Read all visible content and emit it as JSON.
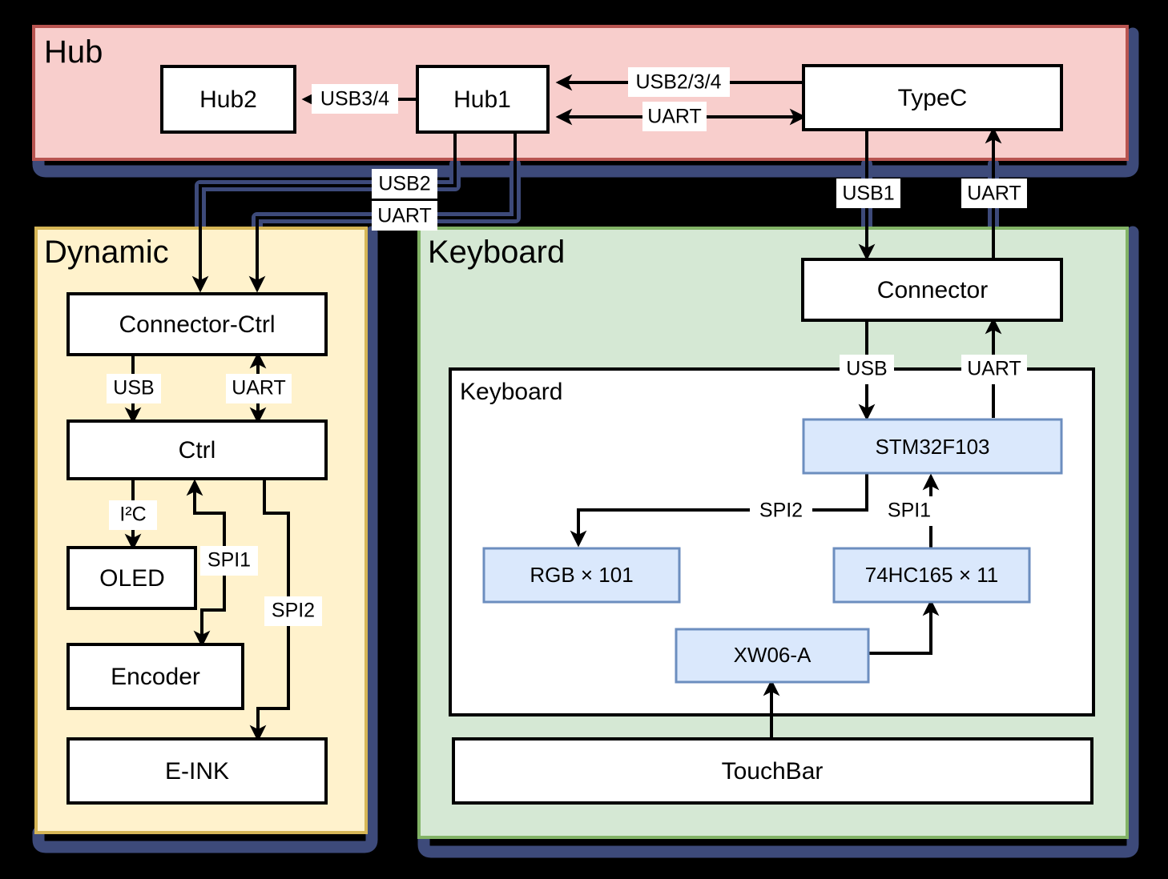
{
  "diagram": {
    "title": "Hub / Dynamic / Keyboard hardware block diagram",
    "colors": {
      "background": "#000000",
      "hub_fill": "#F8CECC",
      "hub_border": "#B85450",
      "dynamic_fill": "#FFF2CC",
      "dynamic_border": "#D6B656",
      "keyboard_fill": "#D5E8D4",
      "keyboard_border": "#82B366",
      "chip_fill": "#DAE8FC",
      "chip_border": "#6C8EBF",
      "node_fill": "#FFFFFF",
      "node_border": "#000000",
      "shadow": "#3D4A7A"
    },
    "groups": [
      {
        "id": "hub",
        "label": "Hub"
      },
      {
        "id": "dynamic",
        "label": "Dynamic"
      },
      {
        "id": "keyboard",
        "label": "Keyboard"
      },
      {
        "id": "keyboard-inner",
        "label": "Keyboard"
      }
    ],
    "nodes": [
      {
        "id": "hub2",
        "label": "Hub2",
        "group": "hub",
        "style": "white"
      },
      {
        "id": "hub1",
        "label": "Hub1",
        "group": "hub",
        "style": "white"
      },
      {
        "id": "typec",
        "label": "TypeC",
        "group": "hub",
        "style": "white"
      },
      {
        "id": "connector-ctrl",
        "label": "Connector-Ctrl",
        "group": "dynamic",
        "style": "white"
      },
      {
        "id": "ctrl",
        "label": "Ctrl",
        "group": "dynamic",
        "style": "white"
      },
      {
        "id": "oled",
        "label": "OLED",
        "group": "dynamic",
        "style": "white"
      },
      {
        "id": "encoder",
        "label": "Encoder",
        "group": "dynamic",
        "style": "white"
      },
      {
        "id": "eink",
        "label": "E-INK",
        "group": "dynamic",
        "style": "white"
      },
      {
        "id": "connector",
        "label": "Connector",
        "group": "keyboard",
        "style": "white"
      },
      {
        "id": "stm32f103",
        "label": "STM32F103",
        "group": "keyboard-inner",
        "style": "blue"
      },
      {
        "id": "rgb",
        "label": "RGB × 101",
        "group": "keyboard-inner",
        "style": "blue"
      },
      {
        "id": "hc165",
        "label": "74HC165 × 11",
        "group": "keyboard-inner",
        "style": "blue"
      },
      {
        "id": "xw06a",
        "label": "XW06-A",
        "group": "keyboard-inner",
        "style": "blue"
      },
      {
        "id": "touchbar",
        "label": "TouchBar",
        "group": "keyboard",
        "style": "white"
      }
    ],
    "edges": [
      {
        "id": "e-hub1-hub2",
        "from": "hub1",
        "to": "hub2",
        "label": "USB3/4",
        "direction": "one-way"
      },
      {
        "id": "e-typec-hub1-usb",
        "from": "typec",
        "to": "hub1",
        "label": "USB2/3/4",
        "direction": "one-way"
      },
      {
        "id": "e-typec-hub1-uart",
        "from": "typec",
        "to": "hub1",
        "label": "UART",
        "direction": "two-way"
      },
      {
        "id": "e-hub1-dyn-usb2",
        "from": "hub1",
        "to": "connector-ctrl",
        "label": "USB2",
        "direction": "one-way"
      },
      {
        "id": "e-hub1-dyn-uart",
        "from": "hub1",
        "to": "connector-ctrl",
        "label": "UART",
        "direction": "one-way"
      },
      {
        "id": "e-typec-connector-usb1",
        "from": "typec",
        "to": "connector",
        "label": "USB1",
        "direction": "one-way"
      },
      {
        "id": "e-typec-connector-uart",
        "from": "connector",
        "to": "typec",
        "label": "UART",
        "direction": "one-way"
      },
      {
        "id": "e-cc-ctrl-usb",
        "from": "connector-ctrl",
        "to": "ctrl",
        "label": "USB",
        "direction": "one-way"
      },
      {
        "id": "e-cc-ctrl-uart",
        "from": "ctrl",
        "to": "connector-ctrl",
        "label": "UART",
        "direction": "two-way"
      },
      {
        "id": "e-ctrl-oled",
        "from": "ctrl",
        "to": "oled",
        "label": "I²C",
        "direction": "one-way"
      },
      {
        "id": "e-encoder-ctrl",
        "from": "encoder",
        "to": "ctrl",
        "label": "SPI1",
        "direction": "one-way"
      },
      {
        "id": "e-ctrl-eink",
        "from": "ctrl",
        "to": "eink",
        "label": "SPI2",
        "direction": "one-way"
      },
      {
        "id": "e-connector-stm-usb",
        "from": "connector",
        "to": "stm32f103",
        "label": "USB",
        "direction": "one-way"
      },
      {
        "id": "e-stm-connector-uart",
        "from": "stm32f103",
        "to": "connector",
        "label": "UART",
        "direction": "one-way"
      },
      {
        "id": "e-stm-rgb",
        "from": "stm32f103",
        "to": "rgb",
        "label": "SPI2",
        "direction": "one-way"
      },
      {
        "id": "e-hc165-stm",
        "from": "hc165",
        "to": "stm32f103",
        "label": "SPI1",
        "direction": "one-way"
      },
      {
        "id": "e-xw06a-hc165",
        "from": "xw06a",
        "to": "hc165",
        "label": "",
        "direction": "one-way"
      },
      {
        "id": "e-touchbar-xw06a",
        "from": "touchbar",
        "to": "xw06a",
        "label": "",
        "direction": "one-way"
      }
    ],
    "edge_labels": {
      "usb34": "USB3/4",
      "usb234": "USB2/3/4",
      "uart": "UART",
      "usb2": "USB2",
      "usb1": "USB1",
      "usb": "USB",
      "i2c": "I²C",
      "spi1": "SPI1",
      "spi2": "SPI2"
    }
  }
}
